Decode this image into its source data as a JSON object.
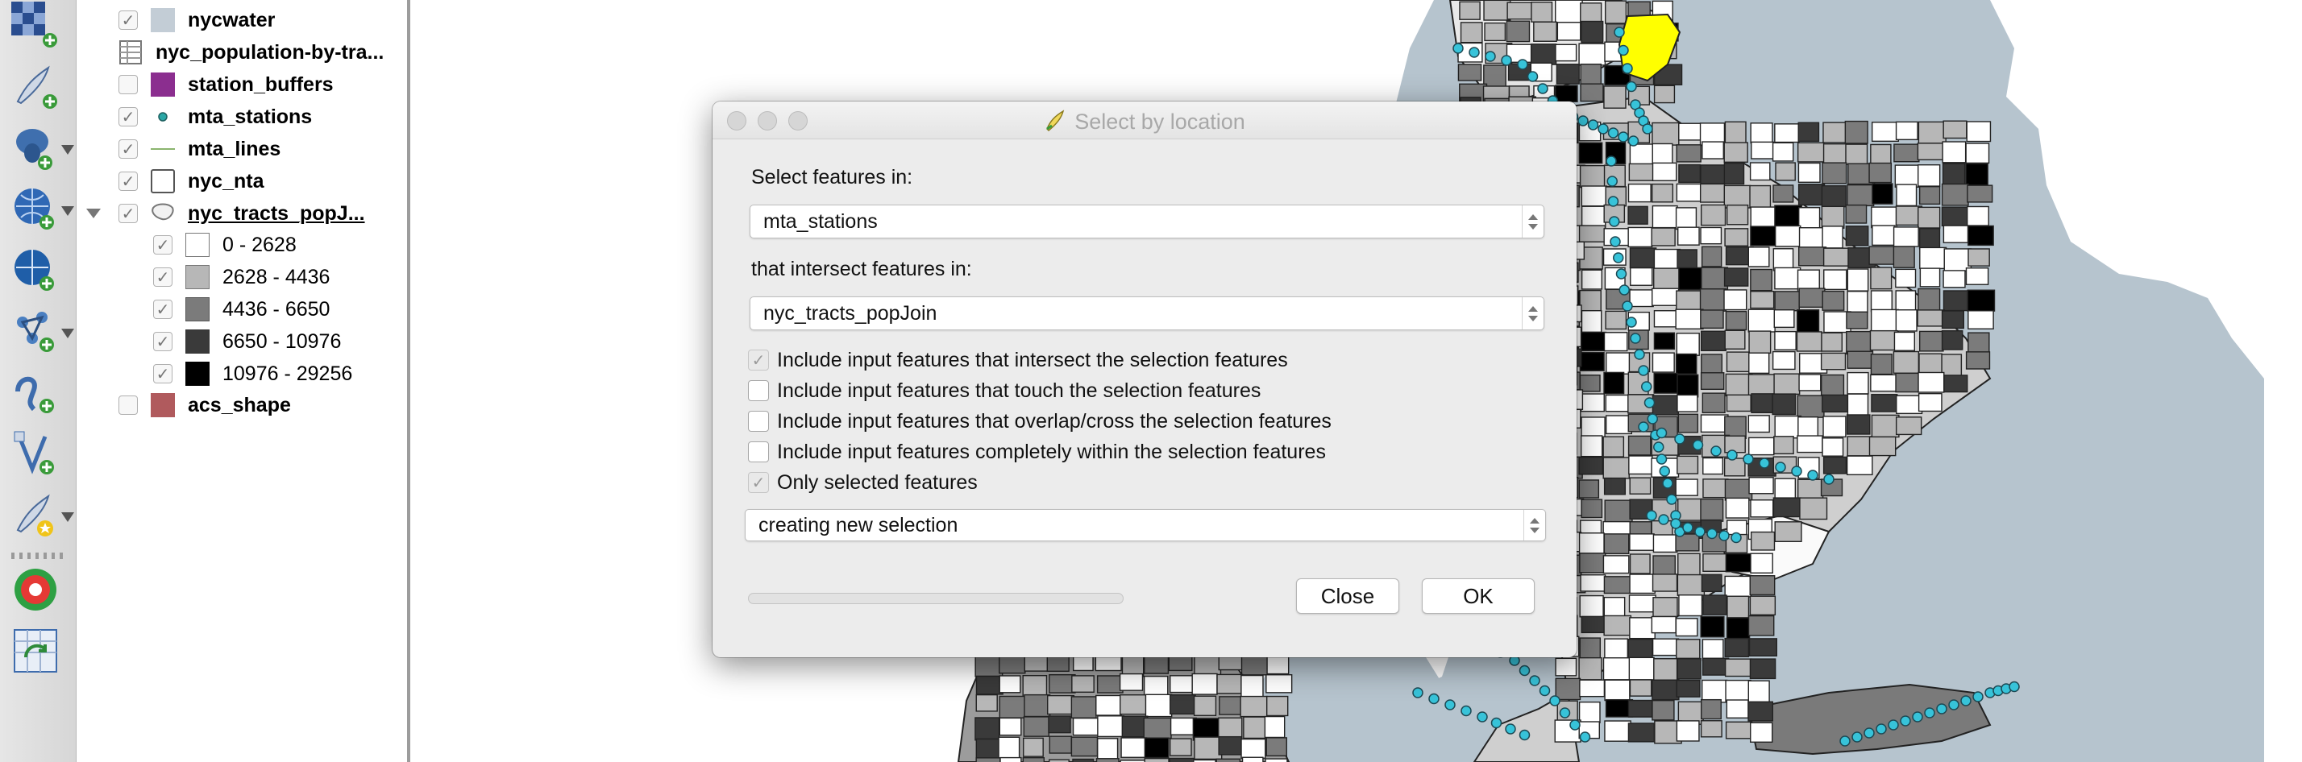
{
  "layers_panel": {
    "items": [
      {
        "name": "nycwater",
        "checked": true,
        "symbol": "fill",
        "color": "#c3cdd6"
      },
      {
        "name": "nyc_population-by-tra...",
        "checked": null,
        "symbol": "table",
        "color": "#ffffff"
      },
      {
        "name": "station_buffers",
        "checked": false,
        "symbol": "fill",
        "color": "#8b2e8f"
      },
      {
        "name": "mta_stations",
        "checked": true,
        "symbol": "point",
        "color": "#2aa7a6"
      },
      {
        "name": "mta_lines",
        "checked": true,
        "symbol": "line",
        "color": "#8ab56e"
      },
      {
        "name": "nyc_nta",
        "checked": true,
        "symbol": "outline",
        "color": "#ffffff"
      },
      {
        "name": "nyc_tracts_popJ...",
        "checked": true,
        "symbol": "polygon-group",
        "color": "#ffffff",
        "expanded": true
      },
      {
        "name": "acs_shape",
        "checked": false,
        "symbol": "fill",
        "color": "#b05a5d"
      }
    ],
    "classes": [
      {
        "label": "0 - 2628",
        "checked": true,
        "color": "#ffffff"
      },
      {
        "label": "2628 - 4436",
        "checked": true,
        "color": "#b7b7b7"
      },
      {
        "label": "4436 - 6650",
        "checked": true,
        "color": "#7b7b7b"
      },
      {
        "label": "6650 - 10976",
        "checked": true,
        "color": "#3a3a3a"
      },
      {
        "label": "10976 - 29256",
        "checked": true,
        "color": "#000000"
      }
    ]
  },
  "toolbar": {
    "tools": [
      {
        "icon": "checkerboard-icon",
        "caret": false
      },
      {
        "icon": "add-vector-layer-icon",
        "caret": false
      },
      {
        "icon": "add-postgis-layer-icon",
        "caret": true
      },
      {
        "icon": "add-wms-layer-icon",
        "caret": true
      },
      {
        "icon": "add-wcs-layer-icon",
        "caret": false
      },
      {
        "icon": "add-wfs-layer-icon",
        "caret": true
      },
      {
        "icon": "add-spatialite-layer-icon",
        "caret": false
      },
      {
        "icon": "add-virtual-layer-icon",
        "caret": false
      },
      {
        "icon": "new-shapefile-layer-icon",
        "caret": true
      },
      {
        "icon": "plugin-icon",
        "caret": false
      },
      {
        "icon": "refresh-layer-icon",
        "caret": false
      }
    ]
  },
  "dialog": {
    "title": "Select by location",
    "select_label": "Select features in:",
    "select_value": "mta_stations",
    "intersect_label": "that intersect features in:",
    "intersect_value": "nyc_tracts_popJoin",
    "options": [
      {
        "label": "Include input features that intersect the selection features",
        "checked": true,
        "disabled": true
      },
      {
        "label": "Include input features that touch the selection features",
        "checked": false,
        "disabled": false
      },
      {
        "label": "Include input features that overlap/cross the selection features",
        "checked": false,
        "disabled": false
      },
      {
        "label": "Include input features completely within the selection features",
        "checked": false,
        "disabled": false
      },
      {
        "label": "Only selected features",
        "checked": true,
        "disabled": true
      }
    ],
    "mode_value": "creating new selection",
    "progress": 0,
    "close_label": "Close",
    "ok_label": "OK"
  },
  "colors": {
    "water": "#b6c4ce",
    "station": "#37c3d9",
    "selected": "#ffff00",
    "dialog_bg": "#ececec"
  }
}
